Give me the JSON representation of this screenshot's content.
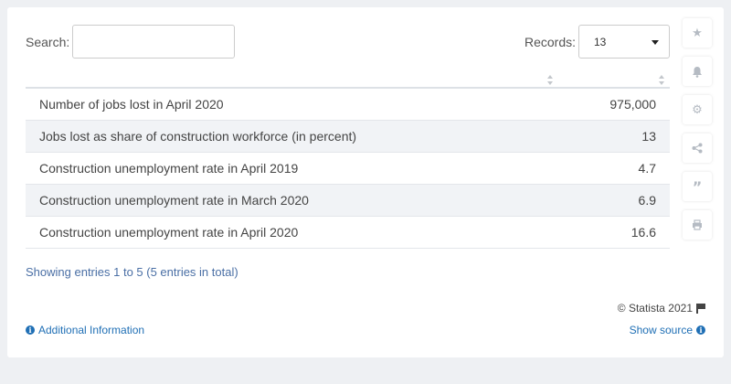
{
  "search": {
    "label": "Search:",
    "value": "",
    "placeholder": ""
  },
  "records": {
    "label": "Records:",
    "selected": "13"
  },
  "table": {
    "rows": [
      {
        "label": "Number of jobs lost in April 2020",
        "value": "975,000"
      },
      {
        "label": "Jobs lost as share of construction workforce (in percent)",
        "value": "13"
      },
      {
        "label": "Construction unemployment rate in April 2019",
        "value": "4.7"
      },
      {
        "label": "Construction unemployment rate in March 2020",
        "value": "6.9"
      },
      {
        "label": "Construction unemployment rate in April 2020",
        "value": "16.6"
      }
    ]
  },
  "footer": {
    "entries": "Showing entries 1 to 5 (5 entries in total)",
    "copyright": "© Statista 2021",
    "additional_info": "Additional Information",
    "show_source": "Show source"
  },
  "sidebar": {
    "icons": [
      "star-icon",
      "bell-icon",
      "gear-icon",
      "share-icon",
      "quote-icon",
      "print-icon"
    ]
  },
  "colors": {
    "link": "#1f6fb5",
    "row_alt": "#f1f3f6",
    "background": "#eef0f3"
  }
}
